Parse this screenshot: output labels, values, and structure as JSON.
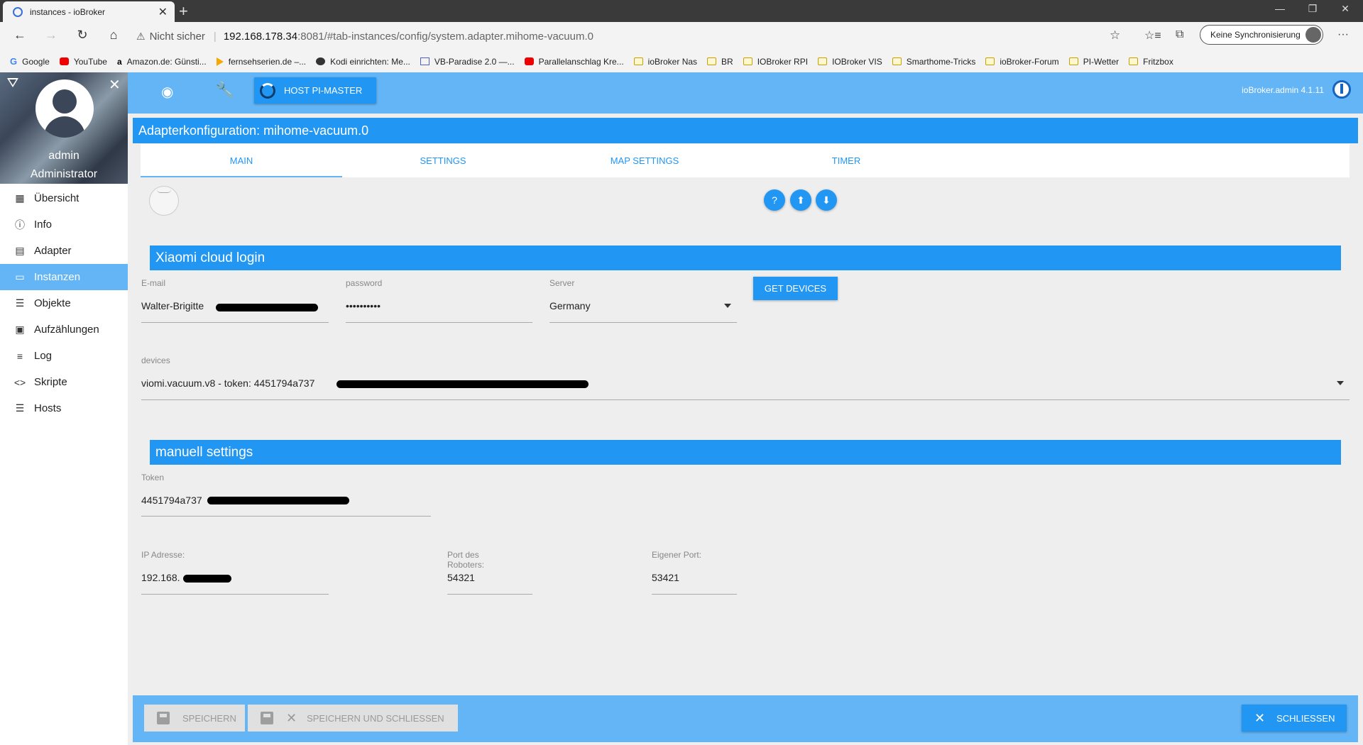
{
  "browser": {
    "tab_title": "instances - ioBroker",
    "url_warning": "Nicht sicher",
    "url_host": "192.168.178.34",
    "url_path": ":8081/#tab-instances/config/system.adapter.mihome-vacuum.0",
    "sync_label": "Keine Synchronisierung",
    "bookmarks": [
      {
        "label": "Google",
        "icon": "g"
      },
      {
        "label": "YouTube",
        "icon": "yt"
      },
      {
        "label": "Amazon.de: Günsti...",
        "icon": "am"
      },
      {
        "label": "fernsehserien.de –...",
        "icon": "fs"
      },
      {
        "label": "Kodi einrichten: Me...",
        "icon": "kodi"
      },
      {
        "label": "VB-Paradise 2.0 —...",
        "icon": "vb"
      },
      {
        "label": "Parallelanschlag Kre...",
        "icon": "yt"
      },
      {
        "label": "ioBroker Nas",
        "icon": "folder"
      },
      {
        "label": "BR",
        "icon": "folder"
      },
      {
        "label": "IOBroker RPI",
        "icon": "folder"
      },
      {
        "label": "IOBroker VIS",
        "icon": "folder"
      },
      {
        "label": "Smarthome-Tricks",
        "icon": "folder"
      },
      {
        "label": "ioBroker-Forum",
        "icon": "folder"
      },
      {
        "label": "PI-Wetter",
        "icon": "folder"
      },
      {
        "label": "Fritzbox",
        "icon": "folder"
      }
    ]
  },
  "profile": {
    "name": "admin",
    "role": "Administrator"
  },
  "nav": [
    {
      "label": "Übersicht",
      "icon": "grid-icon"
    },
    {
      "label": "Info",
      "icon": "info-icon"
    },
    {
      "label": "Adapter",
      "icon": "store-icon"
    },
    {
      "label": "Instanzen",
      "icon": "instances-icon"
    },
    {
      "label": "Objekte",
      "icon": "list-icon"
    },
    {
      "label": "Aufzählungen",
      "icon": "enum-icon"
    },
    {
      "label": "Log",
      "icon": "log-icon"
    },
    {
      "label": "Skripte",
      "icon": "code-icon"
    },
    {
      "label": "Hosts",
      "icon": "hosts-icon"
    }
  ],
  "topbar": {
    "host_label": "HOST PI-MASTER",
    "version": "ioBroker.admin 4.1.11"
  },
  "dialog": {
    "title": "Adapterkonfiguration: mihome-vacuum.0",
    "tabs": [
      "MAIN",
      "SETTINGS",
      "MAP SETTINGS",
      "TIMER"
    ],
    "cloud": {
      "section_title": "Xiaomi cloud login",
      "email_label": "E-mail",
      "email_value": "Walter-Brigitte",
      "password_label": "password",
      "password_value": "••••••••••",
      "server_label": "Server",
      "server_value": "Germany",
      "get_devices": "GET DEVICES",
      "devices_label": "devices",
      "devices_value": "viomi.vacuum.v8 - token: 4451794a737"
    },
    "manual": {
      "section_title": "manuell settings",
      "token_label": "Token",
      "token_value": "4451794a737",
      "ip_label": "IP Adresse:",
      "ip_value": "192.168.",
      "port_label": "Port des Roboters:",
      "port_value": "54321",
      "own_port_label": "Eigener Port:",
      "own_port_value": "53421"
    },
    "footer": {
      "save": "SPEICHERN",
      "save_close": "SPEICHERN UND SCHLIESSEN",
      "close": "SCHLIESSEN"
    }
  }
}
